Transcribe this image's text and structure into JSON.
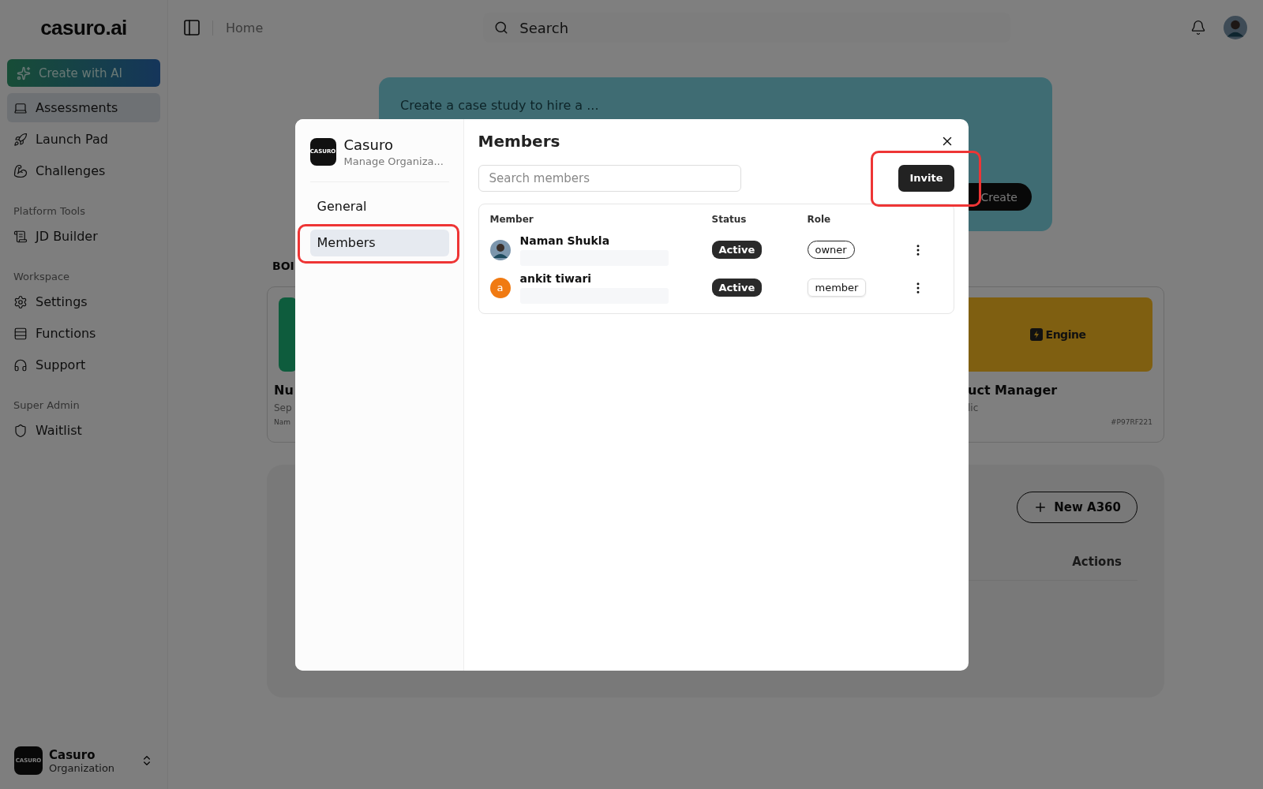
{
  "sidebar": {
    "logo": "casuro.ai",
    "create_button": "Create with AI",
    "sections": [
      {
        "items": [
          {
            "label": "Assessments",
            "selected": true
          },
          {
            "label": "Launch Pad",
            "selected": false
          },
          {
            "label": "Challenges",
            "selected": false
          }
        ]
      },
      {
        "title": "Platform Tools",
        "items": [
          {
            "label": "JD Builder",
            "selected": false
          }
        ]
      },
      {
        "title": "Workspace",
        "items": [
          {
            "label": "Settings",
            "selected": false
          },
          {
            "label": "Functions",
            "selected": false
          },
          {
            "label": "Support",
            "selected": false
          }
        ]
      },
      {
        "title": "Super Admin",
        "items": [
          {
            "label": "Waitlist",
            "selected": false
          }
        ]
      }
    ],
    "organization": {
      "logo": "CASURO",
      "name": "Casuro",
      "subtitle": "Organization"
    }
  },
  "header": {
    "breadcrumb": "Home",
    "search": {
      "placeholder": "Search"
    }
  },
  "banner": {
    "prompt": "Create a case study to hire a ...",
    "button": "Create"
  },
  "section_label": "BOI",
  "cards": [
    {
      "title": "Nu",
      "subtitle": "Sep",
      "meta": "Nam"
    },
    {
      "logo": "Engine",
      "title": "uct Manager",
      "subtitle": "lic",
      "meta": "#P97RF221"
    }
  ],
  "panel": {
    "new_button": "New A360",
    "column": "Actions"
  },
  "dialog": {
    "org_logo": "CASURO",
    "org_name": "Casuro",
    "org_subtitle": "Manage Organiza...",
    "nav": [
      {
        "label": "General",
        "selected": false,
        "highlighted": false
      },
      {
        "label": "Members",
        "selected": true,
        "highlighted": true
      }
    ],
    "title": "Members",
    "search": {
      "placeholder": "Search members"
    },
    "invite_button": {
      "label": "Invite",
      "highlighted": true
    },
    "columns": [
      "Member",
      "Status",
      "Role"
    ],
    "members": [
      {
        "name": "Naman Shukla",
        "status": "Active",
        "role": {
          "kind": "badge",
          "label": "owner"
        }
      },
      {
        "name": "ankit tiwari",
        "avatar": {
          "kind": "initial",
          "text": "a"
        },
        "status": "Active",
        "role": {
          "kind": "select",
          "label": "member"
        }
      }
    ]
  }
}
